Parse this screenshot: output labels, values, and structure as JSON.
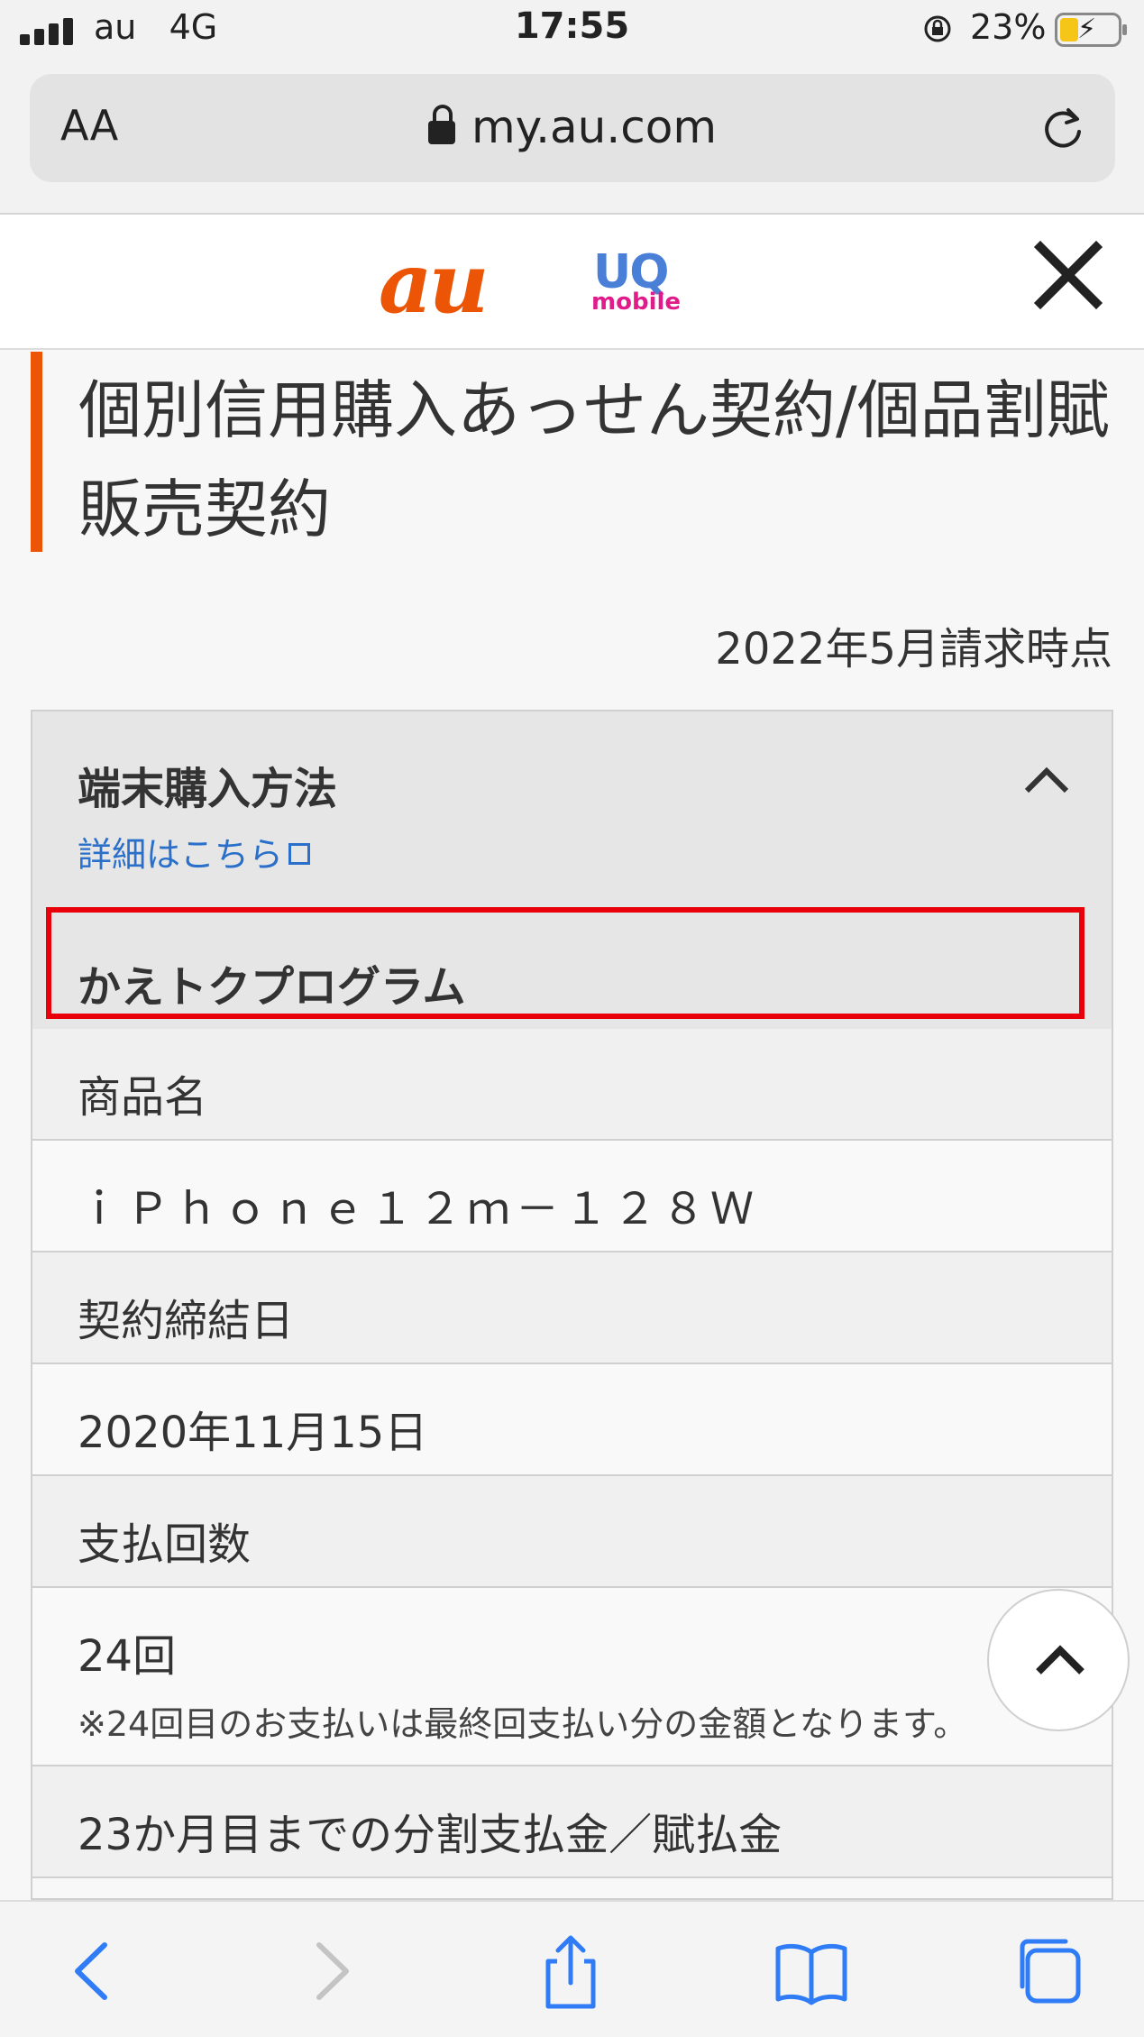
{
  "status_bar": {
    "carrier": "au",
    "network": "4G",
    "time": "17:55",
    "battery_percent": "23%"
  },
  "browser": {
    "text_size_label": "AA",
    "url": "my.au.com"
  },
  "header": {
    "logo_au": "au",
    "logo_uq": "UQ",
    "logo_uq_sub": "mobile"
  },
  "page": {
    "title": "個別信用購入あっせん契約/個品割賦販売契約",
    "as_of": "2022年5月請求時点"
  },
  "card": {
    "title": "端末購入方法",
    "link": "詳細はこちら",
    "section_label": "かえトクプログラム",
    "rows": [
      {
        "label": "商品名",
        "value": "ｉＰｈｏｎｅ１２ｍ－１２８Ｗ"
      },
      {
        "label": "契約締結日",
        "value": "2020年11月15日"
      },
      {
        "label": "支払回数",
        "value": "24回",
        "note": "※24回目のお支払いは最終回支払い分の金額となります。"
      },
      {
        "label": "23か月目までの分割支払金／賦払金"
      }
    ]
  },
  "colors": {
    "brand_orange": "#eb5505",
    "link_blue": "#2a6fc9",
    "highlight_red": "#e8000a"
  }
}
